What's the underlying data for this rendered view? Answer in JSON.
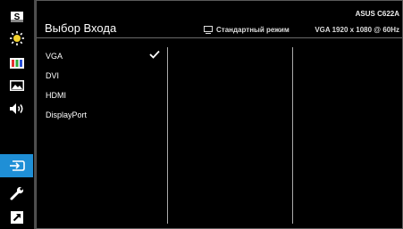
{
  "sidebar": {
    "items": [
      {
        "icon": "splendid-s-icon"
      },
      {
        "icon": "brightness-icon"
      },
      {
        "icon": "color-icon"
      },
      {
        "icon": "image-icon"
      },
      {
        "icon": "sound-icon"
      },
      {
        "icon": "input-select-icon",
        "active": true
      },
      {
        "icon": "system-setup-icon"
      },
      {
        "icon": "shortcut-icon"
      }
    ],
    "active_color": "#1f8fd6"
  },
  "header": {
    "title": "Выбор Входа",
    "model": "ASUS C622A",
    "mode_label": "Стандартный режим",
    "resolution": "VGA 1920 x 1080 @ 60Hz"
  },
  "menu": {
    "items": [
      {
        "label": "VGA",
        "selected": true
      },
      {
        "label": "DVI"
      },
      {
        "label": "HDMI"
      },
      {
        "label": "DisplayPort"
      }
    ]
  }
}
